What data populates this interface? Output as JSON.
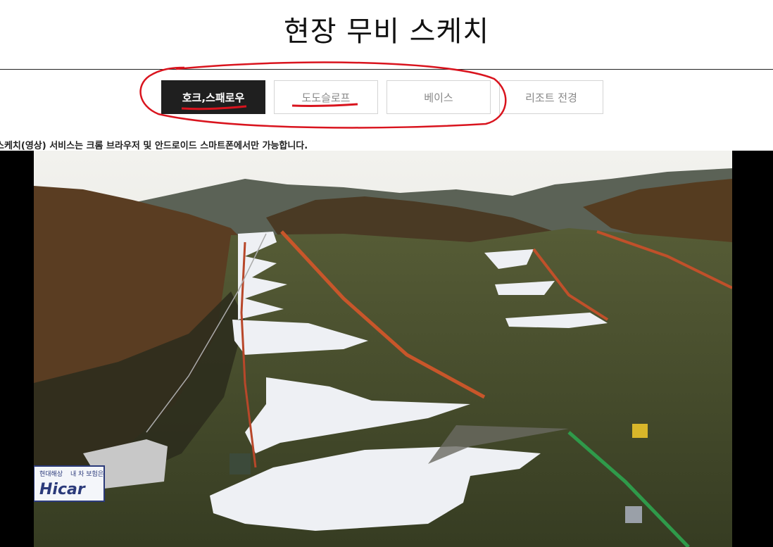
{
  "page": {
    "title": "현장 무비 스케치"
  },
  "tabs": [
    {
      "label": "호크,스패로우",
      "active": true
    },
    {
      "label": "도도슬로프",
      "active": false
    },
    {
      "label": "베이스",
      "active": false
    },
    {
      "label": "리조트 전경",
      "active": false
    }
  ],
  "notice": "스케치(영상) 서비스는 크롬 브라우저 및 안드로이드 스마트폰에서만 가능합니다.",
  "video": {
    "signage": {
      "brand": "Hicar",
      "sub": "현대해상",
      "slogan": "내 차 보험은"
    }
  },
  "colors": {
    "annotation": "#d9141e",
    "active_tab": "#1f1f1f",
    "grass": "#3d4426",
    "snow": "#eef0f4"
  }
}
